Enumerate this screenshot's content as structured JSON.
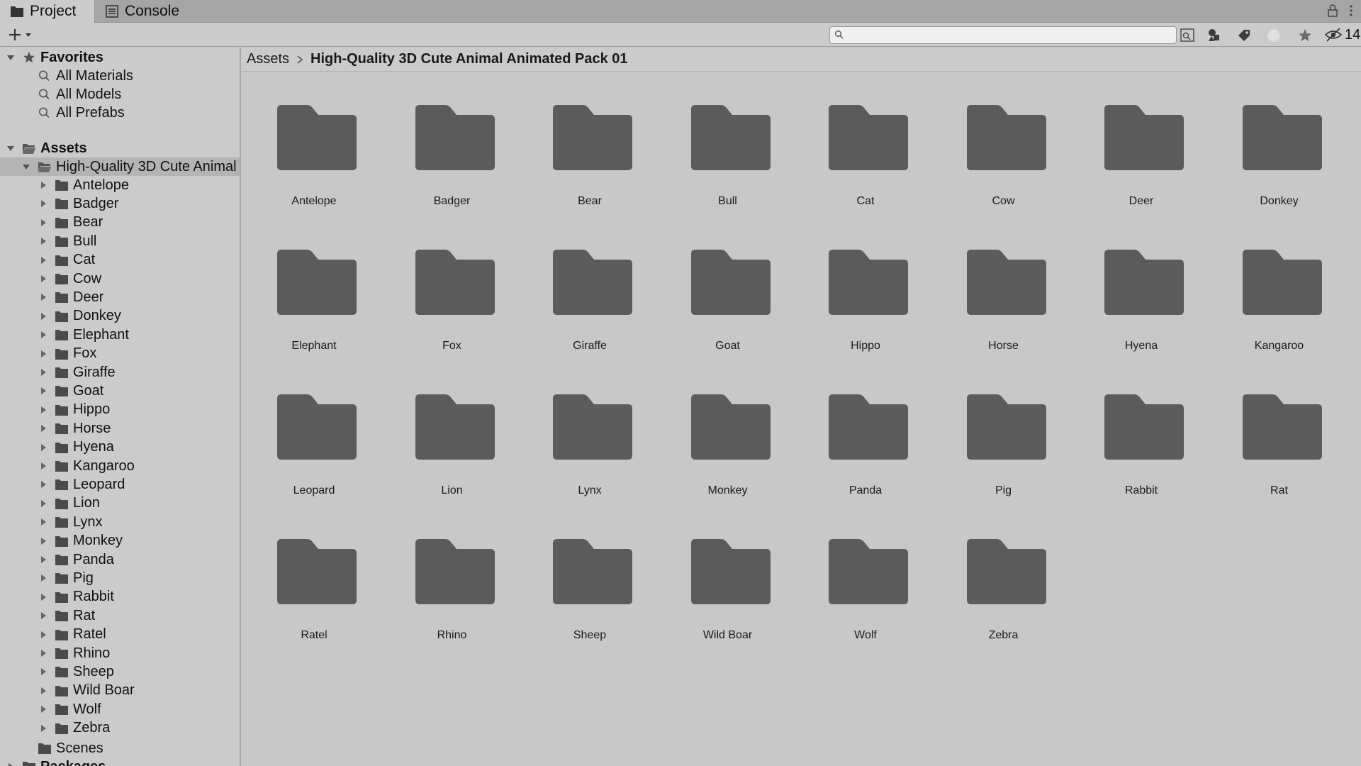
{
  "tabs": [
    {
      "label": "Project",
      "icon": "folder-icon",
      "active": true
    },
    {
      "label": "Console",
      "icon": "console-icon",
      "active": false
    }
  ],
  "toolbar": {
    "create_label": "+",
    "search_placeholder": "",
    "hidden_count": "14"
  },
  "favorites": {
    "label": "Favorites",
    "items": [
      "All Materials",
      "All Models",
      "All Prefabs"
    ]
  },
  "assets": {
    "label": "Assets",
    "pack": "High-Quality 3D Cute Animal Animated Pack 01",
    "scenes": "Scenes"
  },
  "packages": {
    "label": "Packages"
  },
  "breadcrumb": {
    "root": "Assets",
    "current": "High-Quality 3D Cute Animal Animated Pack 01"
  },
  "folders": [
    "Antelope",
    "Badger",
    "Bear",
    "Bull",
    "Cat",
    "Cow",
    "Deer",
    "Donkey",
    "Elephant",
    "Fox",
    "Giraffe",
    "Goat",
    "Hippo",
    "Horse",
    "Hyena",
    "Kangaroo",
    "Leopard",
    "Lion",
    "Lynx",
    "Monkey",
    "Panda",
    "Pig",
    "Rabbit",
    "Rat",
    "Ratel",
    "Rhino",
    "Sheep",
    "Wild Boar",
    "Wolf",
    "Zebra"
  ],
  "colors": {
    "folder": "#5b5b5b",
    "panel": "#cbcbcb",
    "grid": "#c8c8c8",
    "selected_row": "#b4b4b4"
  }
}
